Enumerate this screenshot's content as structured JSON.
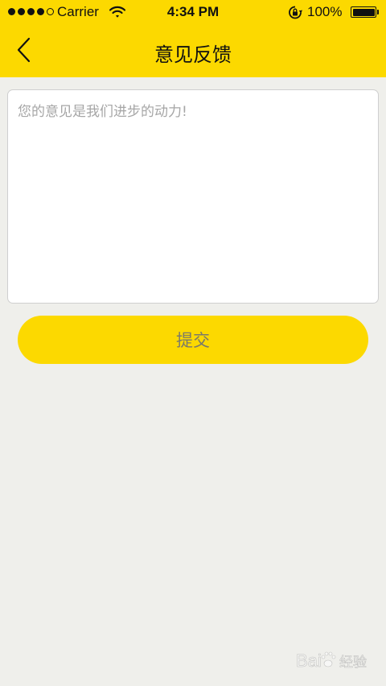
{
  "status_bar": {
    "carrier": "Carrier",
    "time": "4:34 PM",
    "battery": "100%",
    "signal_bars_filled": 4,
    "signal_bars_total": 5,
    "battery_level": 1.0,
    "icons": [
      "wifi-icon",
      "rotation-lock-icon",
      "battery-icon"
    ]
  },
  "nav": {
    "title": "意见反馈",
    "back_icon": "chevron-left-icon"
  },
  "feedback": {
    "placeholder": "您的意见是我们进步的动力!",
    "value": ""
  },
  "submit": {
    "label": "提交"
  },
  "watermark": {
    "icon": "baidu-paw-logo",
    "text": "Bai 经验"
  },
  "colors": {
    "accent": "#fcd900",
    "background": "#efefeb",
    "placeholder": "#a6a6a6"
  }
}
